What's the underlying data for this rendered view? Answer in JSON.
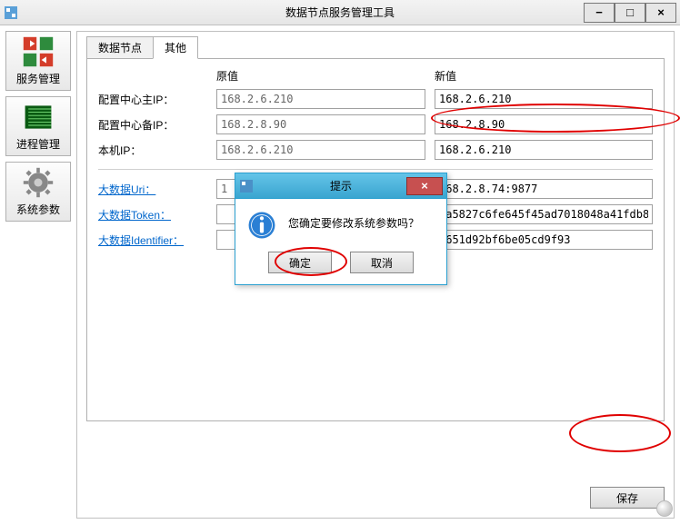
{
  "window": {
    "title": "数据节点服务管理工具",
    "minimize": "−",
    "maximize": "□",
    "close": "×"
  },
  "sidebar": {
    "items": [
      {
        "label": "服务管理"
      },
      {
        "label": "进程管理"
      },
      {
        "label": "系统参数"
      }
    ]
  },
  "tabs": {
    "items": [
      {
        "label": "数据节点"
      },
      {
        "label": "其他"
      }
    ],
    "active_index": 1
  },
  "columns": {
    "old": "原值",
    "new": "新值"
  },
  "rows": [
    {
      "label": "配置中心主IP：",
      "old": "168.2.6.210",
      "new": "168.2.6.210",
      "link": false
    },
    {
      "label": "配置中心备IP：",
      "old": "168.2.8.90",
      "new": "168.2.8.90",
      "link": false
    },
    {
      "label": "本机IP：",
      "old": "168.2.6.210",
      "new": "168.2.6.210",
      "link": false
    }
  ],
  "rows2": [
    {
      "label": "大数据Uri：",
      "old": "1",
      "new": "168.2.8.74:9877",
      "link": true
    },
    {
      "label": "大数据Token：",
      "old": "",
      "new": "5a5827c6fe645f45ad7018048a41fdb8",
      "link": true
    },
    {
      "label": "大数据Identifier：",
      "old": "",
      "new": "1651d92bf6be05cd9f93",
      "link": true
    }
  ],
  "buttons": {
    "save": "保存"
  },
  "dialog": {
    "title": "提示",
    "message": "您确定要修改系统参数吗？",
    "ok": "确定",
    "cancel": "取消",
    "close": "×"
  }
}
